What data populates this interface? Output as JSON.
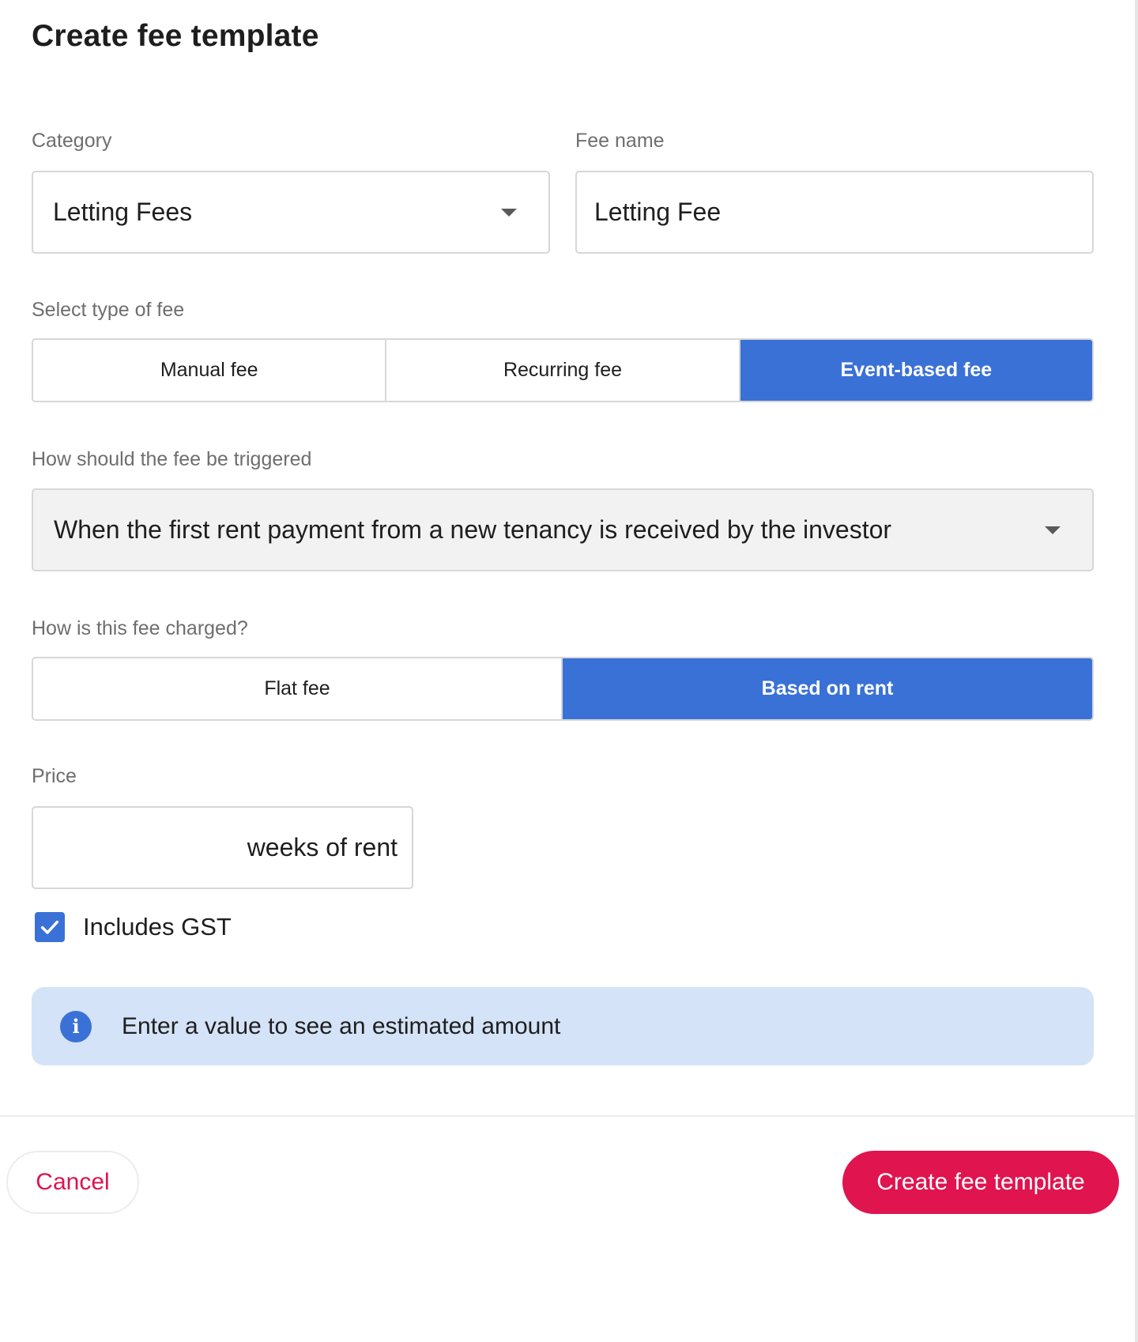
{
  "modal": {
    "title": "Create fee template"
  },
  "category": {
    "label": "Category",
    "value": "Letting Fees"
  },
  "fee_name": {
    "label": "Fee name",
    "value": "Letting Fee"
  },
  "fee_type": {
    "label": "Select type of fee",
    "options": [
      "Manual fee",
      "Recurring fee",
      "Event-based fee"
    ],
    "selected": "Event-based fee"
  },
  "trigger": {
    "label": "How should the fee be triggered",
    "value": "When the first rent payment from a new tenancy is received by the investor"
  },
  "charge_method": {
    "label": "How is this fee charged?",
    "options": [
      "Flat fee",
      "Based on rent"
    ],
    "selected": "Based on rent"
  },
  "price": {
    "label": "Price",
    "value": "",
    "suffix": "weeks of rent"
  },
  "gst": {
    "label": "Includes GST",
    "checked": true
  },
  "info": {
    "icon": "info-icon",
    "text": "Enter a value to see an estimated amount"
  },
  "footer": {
    "cancel_label": "Cancel",
    "create_label": "Create fee template"
  },
  "colors": {
    "accent_blue": "#3a71d6",
    "primary_pink": "#e0144f",
    "info_bg": "#d4e3f7"
  }
}
